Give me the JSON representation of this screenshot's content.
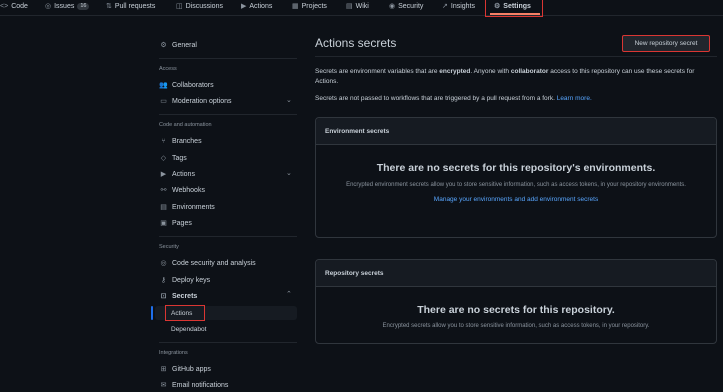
{
  "tabs": [
    {
      "icon": "<>",
      "label": "Code"
    },
    {
      "icon": "◎",
      "label": "Issues",
      "count": "16"
    },
    {
      "icon": "⇅",
      "label": "Pull requests"
    },
    {
      "icon": "◫",
      "label": "Discussions"
    },
    {
      "icon": "▶",
      "label": "Actions"
    },
    {
      "icon": "▦",
      "label": "Projects"
    },
    {
      "icon": "▤",
      "label": "Wiki"
    },
    {
      "icon": "◉",
      "label": "Security"
    },
    {
      "icon": "↗",
      "label": "Insights"
    },
    {
      "icon": "⚙",
      "label": "Settings"
    }
  ],
  "sidebar": {
    "general": "General",
    "access_heading": "Access",
    "collaborators": "Collaborators",
    "moderation": "Moderation options",
    "code_heading": "Code and automation",
    "branches": "Branches",
    "tags": "Tags",
    "actions": "Actions",
    "webhooks": "Webhooks",
    "environments": "Environments",
    "pages": "Pages",
    "security_heading": "Security",
    "code_security": "Code security and analysis",
    "deploy_keys": "Deploy keys",
    "secrets": "Secrets",
    "secrets_actions": "Actions",
    "secrets_dependabot": "Dependabot",
    "integrations_heading": "Integrations",
    "github_apps": "GitHub apps",
    "email_notifications": "Email notifications"
  },
  "main": {
    "title": "Actions secrets",
    "new_button": "New repository secret",
    "desc1_a": "Secrets are environment variables that are ",
    "desc1_b": "encrypted",
    "desc1_c": ". Anyone with ",
    "desc1_d": "collaborator",
    "desc1_e": " access to this repository can use these secrets for Actions.",
    "desc2": "Secrets are not passed to workflows that are triggered by a pull request from a fork. ",
    "learn_more": "Learn more.",
    "env_box": {
      "heading": "Environment secrets",
      "empty_title": "There are no secrets for this repository's environments.",
      "empty_desc": "Encrypted environment secrets allow you to store sensitive information, such as access tokens, in your repository environments.",
      "link": "Manage your environments and add environment secrets"
    },
    "repo_box": {
      "heading": "Repository secrets",
      "empty_title": "There are no secrets for this repository.",
      "empty_desc": "Encrypted secrets allow you to store sensitive information, such as access tokens, in your repository."
    }
  },
  "colors": {
    "background": "#0d1117",
    "accent_link": "#58a6ff",
    "highlight_red": "#da3633",
    "tab_underline": "#f78166"
  }
}
